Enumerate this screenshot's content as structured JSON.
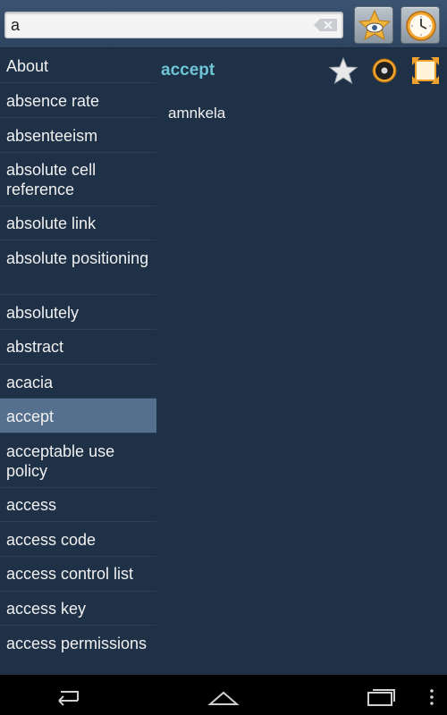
{
  "search": {
    "value": "a",
    "clear_icon": "backspace-clear-icon"
  },
  "toolbar": {
    "favorites_icon": "favorites-star-eye-icon",
    "history_icon": "history-clock-icon"
  },
  "word_list": {
    "items": [
      {
        "label": "About"
      },
      {
        "label": "absence rate"
      },
      {
        "label": "absenteeism"
      },
      {
        "label": "absolute cell reference"
      },
      {
        "label": "absolute link"
      },
      {
        "label": "absolute positioning"
      },
      {
        "label": "absolutely"
      },
      {
        "label": "abstract"
      },
      {
        "label": "acacia"
      },
      {
        "label": "accept"
      },
      {
        "label": "acceptable use policy"
      },
      {
        "label": "access"
      },
      {
        "label": "access code"
      },
      {
        "label": "access control list"
      },
      {
        "label": "access key"
      },
      {
        "label": "access permissions"
      }
    ],
    "selected": "accept"
  },
  "detail": {
    "headword": "accept",
    "translation": "amnkela",
    "headword_color": "#6fc4d6"
  },
  "navbar": {
    "icons": [
      "back-icon",
      "home-icon",
      "recent-apps-icon",
      "overflow-menu-icon"
    ]
  }
}
